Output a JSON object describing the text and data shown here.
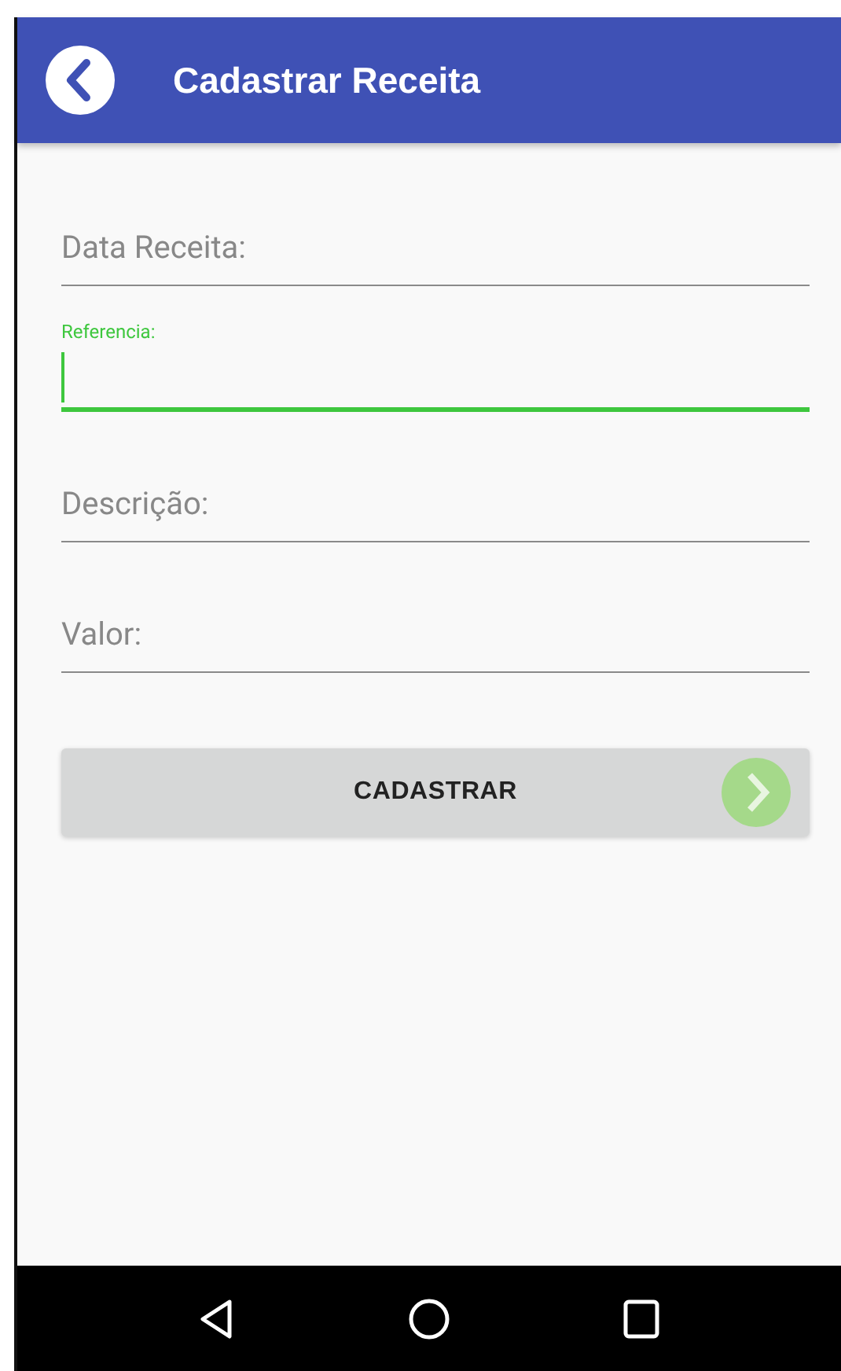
{
  "app_bar": {
    "title": "Cadastrar Receita"
  },
  "fields": [
    {
      "placeholder": "Data Receita:",
      "focused": false
    },
    {
      "placeholder": "Referencia:",
      "focused": true
    },
    {
      "placeholder": "Descrição:",
      "focused": false
    },
    {
      "placeholder": "Valor:",
      "focused": false
    }
  ],
  "submit_button": {
    "label": "CADASTRAR"
  }
}
